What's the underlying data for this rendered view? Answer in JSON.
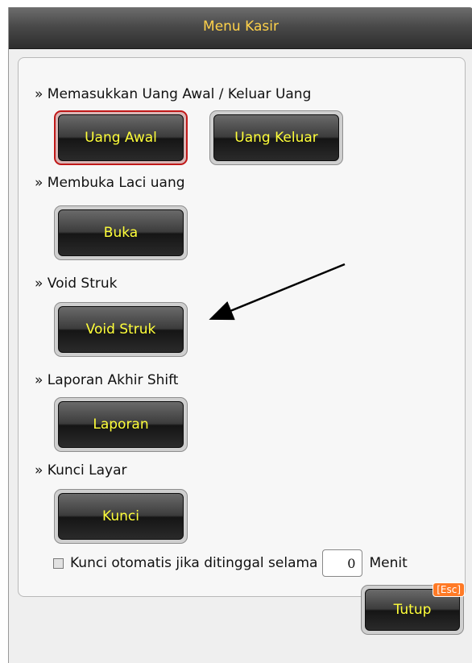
{
  "dialog": {
    "title": "Menu Kasir"
  },
  "sections": {
    "cash": {
      "label": "» Memasukkan Uang Awal / Keluar Uang",
      "buttons": {
        "uang_awal": "Uang Awal",
        "uang_keluar": "Uang Keluar"
      }
    },
    "drawer": {
      "label": "» Membuka Laci uang",
      "button": "Buka"
    },
    "void": {
      "label": "» Void Struk",
      "button": "Void Struk"
    },
    "report": {
      "label": "» Laporan Akhir Shift",
      "button": "Laporan"
    },
    "lock": {
      "label": "» Kunci Layar",
      "button": "Kunci"
    }
  },
  "auto_lock": {
    "checked": false,
    "text": "Kunci otomatis jika ditinggal selama",
    "minutes": "0",
    "unit": "Menit"
  },
  "footer": {
    "close_button": "Tutup",
    "close_shortcut": "[Esc]"
  },
  "colors": {
    "button_text": "#ffff3a",
    "title_text": "#ffd24a",
    "active_border": "#c01818",
    "esc_badge": "#ff7a26"
  }
}
